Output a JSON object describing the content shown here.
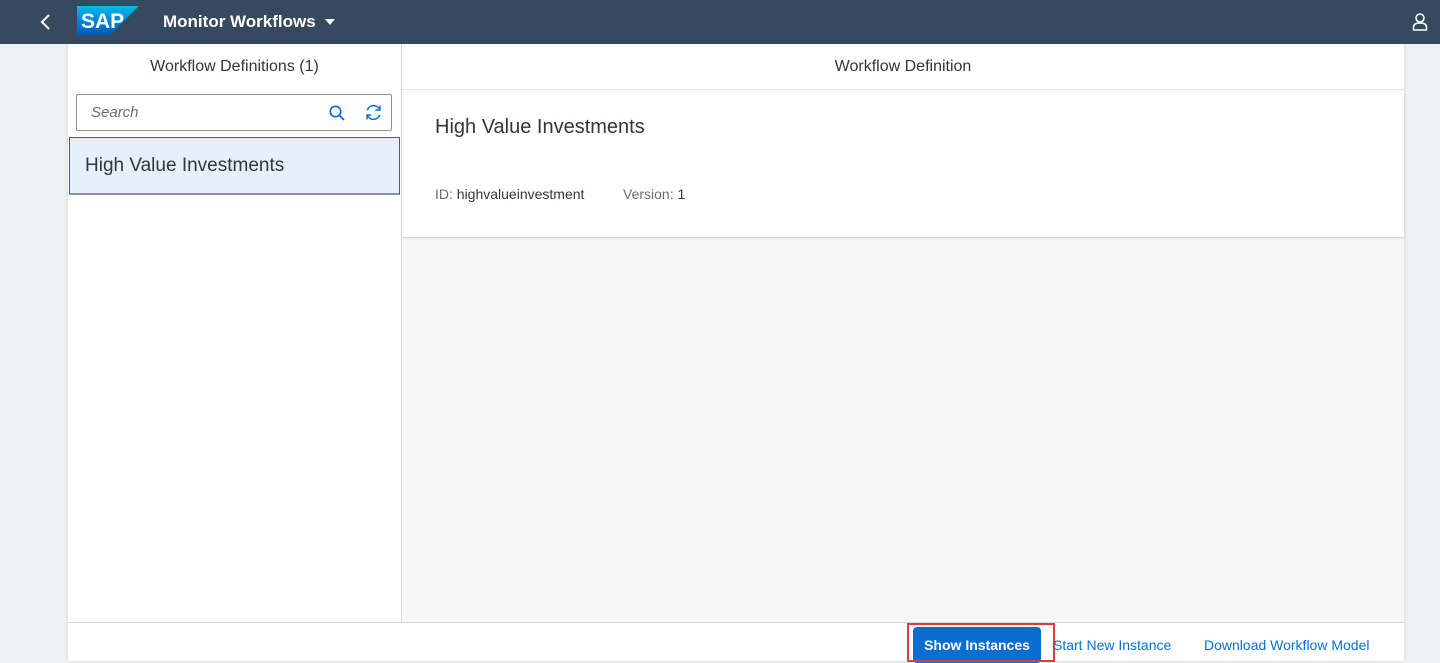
{
  "shell": {
    "logo_text": "SAP",
    "app_title": "Monitor Workflows",
    "colors": {
      "shellbar": "#354a5f",
      "accent": "#0a6ed1",
      "highlight": "#e33b3b"
    }
  },
  "master": {
    "header": "Workflow Definitions (1)",
    "search_placeholder": "Search",
    "items": [
      {
        "label": "High Value Investments",
        "selected": true
      }
    ]
  },
  "detail": {
    "header": "Workflow Definition",
    "title": "High Value Investments",
    "attributes": [
      {
        "label": "ID:",
        "value": "highvalueinvestment"
      },
      {
        "label": "Version:",
        "value": "1"
      }
    ]
  },
  "footer": {
    "show_instances": "Show Instances",
    "start_new_instance": "Start New Instance",
    "download_model": "Download Workflow Model"
  },
  "icons": {
    "back": "chevron-left-icon",
    "user": "person-icon",
    "search": "search-icon",
    "refresh": "refresh-icon",
    "menu": "caret-down-icon"
  }
}
